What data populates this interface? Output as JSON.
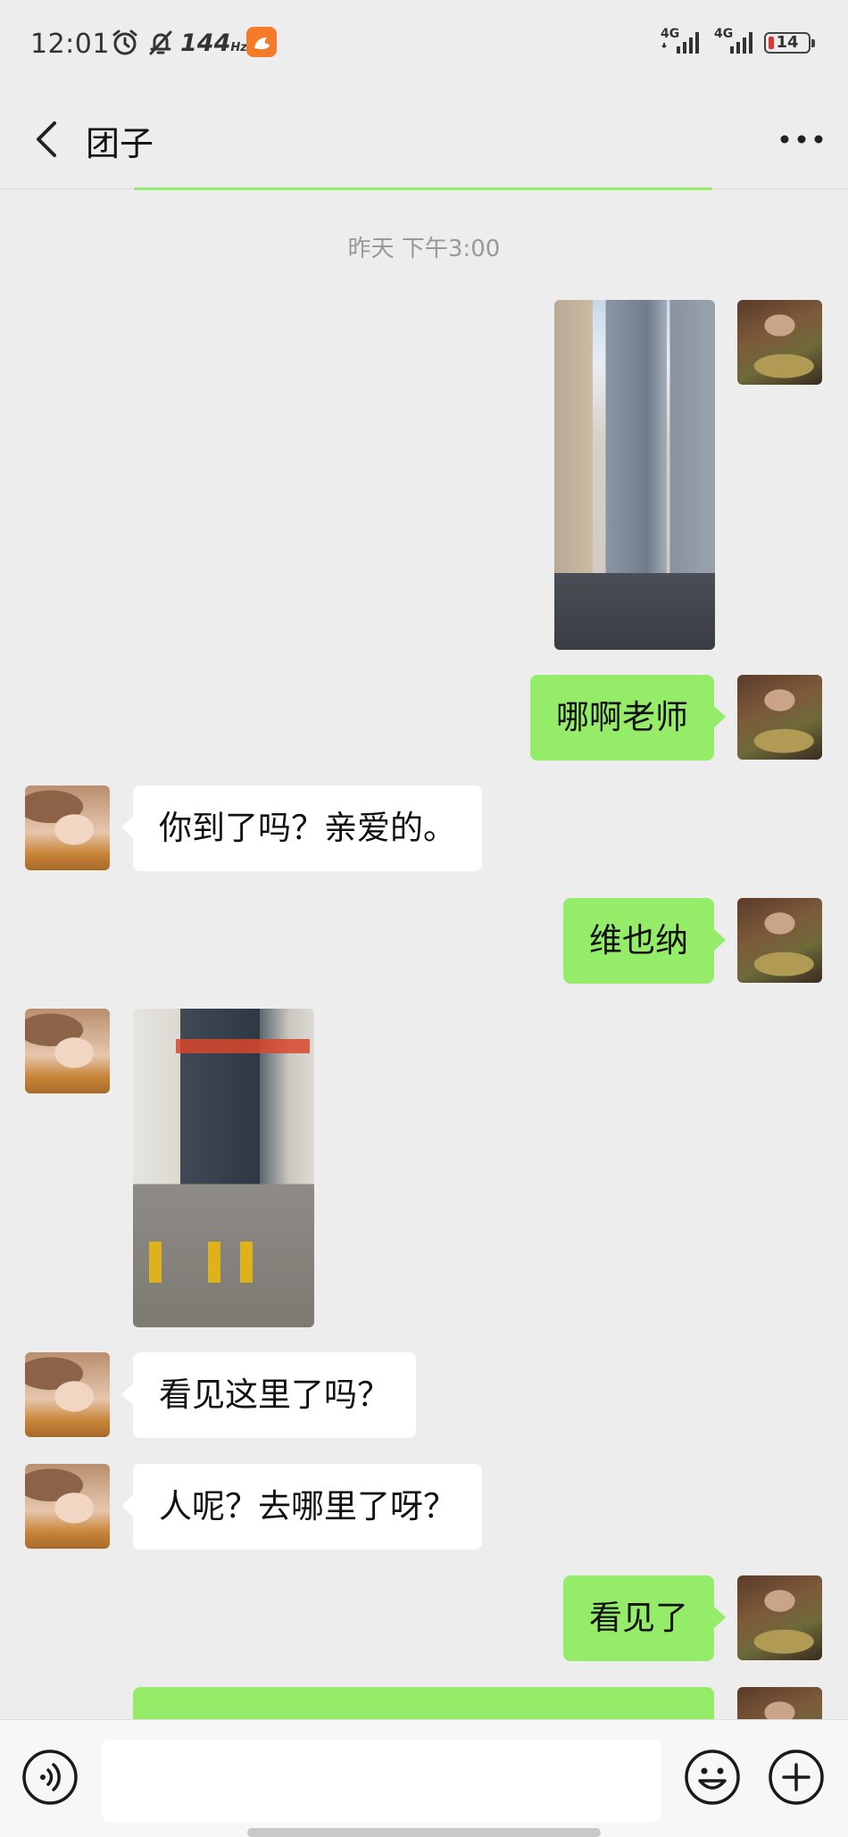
{
  "status_bar": {
    "time": "12:01",
    "refresh_rate": "144",
    "refresh_unit": "Hz",
    "network_1": "4G",
    "network_2": "4G",
    "battery": "14",
    "icons": [
      "alarm-icon",
      "mute-icon",
      "uc-browser-icon",
      "signal-icon",
      "signal-icon",
      "battery-icon"
    ]
  },
  "header": {
    "title": "团子",
    "back_icon": "chevron-left-icon",
    "more_icon": "more-dots-icon"
  },
  "timestamp": "昨天 下午3:00",
  "messages": [
    {
      "from": "self",
      "type": "image",
      "content": "photo of high-rise buildings"
    },
    {
      "from": "self",
      "type": "text",
      "text": "哪啊老师"
    },
    {
      "from": "other",
      "type": "text",
      "text": "你到了吗？亲爱的。"
    },
    {
      "from": "self",
      "type": "text",
      "text": "维也纳"
    },
    {
      "from": "other",
      "type": "image",
      "content": "photo of hotel entrance"
    },
    {
      "from": "other",
      "type": "text",
      "text": "看见这里了吗？"
    },
    {
      "from": "other",
      "type": "text",
      "text": "人呢？去哪里了呀？"
    },
    {
      "from": "self",
      "type": "text",
      "text": "看见了"
    }
  ],
  "input_bar": {
    "value": "",
    "voice_icon": "voice-icon",
    "emoji_icon": "emoji-icon",
    "plus_icon": "plus-icon"
  },
  "colors": {
    "background": "#ededed",
    "self_bubble": "#95ec69",
    "other_bubble": "#ffffff",
    "battery_low": "#e43232"
  }
}
